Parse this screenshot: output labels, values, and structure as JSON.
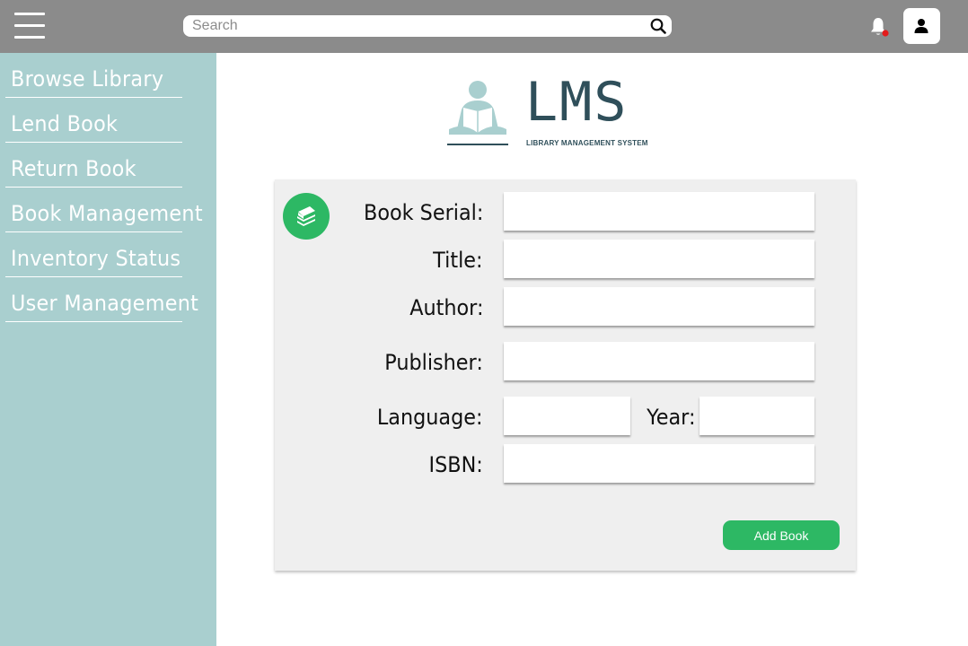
{
  "header": {
    "search": {
      "placeholder": "Search",
      "value": ""
    },
    "notification_indicator_color": "#e31b1b"
  },
  "sidebar": {
    "items": [
      {
        "label": "Browse Library"
      },
      {
        "label": "Lend Book"
      },
      {
        "label": "Return Book"
      },
      {
        "label": "Book Management"
      },
      {
        "label": "Inventory Status"
      },
      {
        "label": "User Management"
      }
    ]
  },
  "logo": {
    "title": "LMS",
    "subtitle": "LIBRARY MANAGEMENT SYSTEM"
  },
  "form": {
    "fields": {
      "book_serial": {
        "label": "Book Serial:",
        "value": ""
      },
      "title": {
        "label": "Title:",
        "value": ""
      },
      "author": {
        "label": "Author:",
        "value": ""
      },
      "publisher": {
        "label": "Publisher:",
        "value": ""
      },
      "language": {
        "label": "Language:",
        "value": ""
      },
      "year": {
        "label": "Year:",
        "value": ""
      },
      "isbn": {
        "label": "ISBN:",
        "value": ""
      }
    },
    "submit_label": "Add Book"
  },
  "colors": {
    "topbar": "#8b8b8b",
    "sidebar": "#a9cfcf",
    "accent": "#2db864",
    "logo": "#2f4f5a"
  },
  "icons": [
    "hamburger-menu-icon",
    "search-icon",
    "bell-icon",
    "user-icon",
    "books-icon",
    "reader-icon"
  ]
}
